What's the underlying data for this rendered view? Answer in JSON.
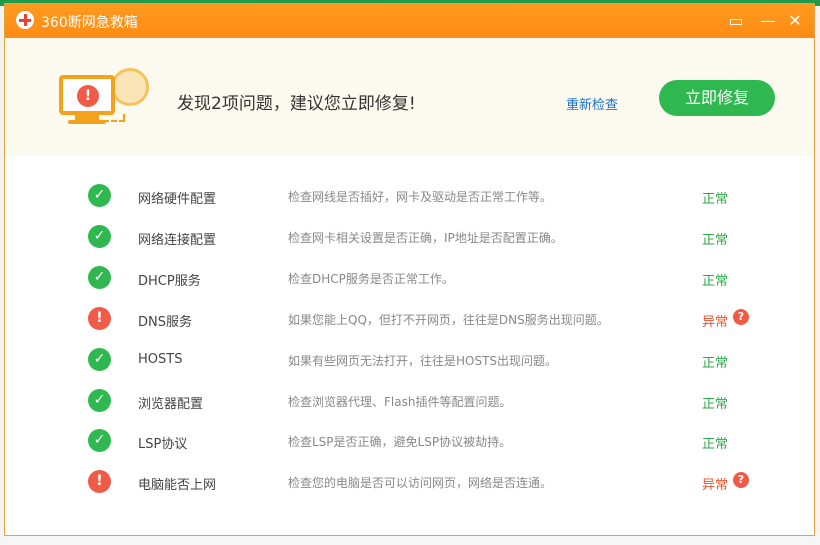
{
  "window": {
    "title": "360断网急救箱",
    "icons": {
      "logo": "red-cross-icon",
      "feedback": "feedback-icon",
      "minimize": "minimize-icon",
      "close": "close-icon"
    }
  },
  "header": {
    "headline": "发现2项问题，建议您立即修复!",
    "recheck_label": "重新检查",
    "fix_label": "立即修复"
  },
  "items": [
    {
      "name": "网络硬件配置",
      "desc": "检查网线是否插好，网卡及驱动是否正常工作等。",
      "result": "正常",
      "status": "ok"
    },
    {
      "name": "网络连接配置",
      "desc": "检查网卡相关设置是否正确，IP地址是否配置正确。",
      "result": "正常",
      "status": "ok"
    },
    {
      "name": "DHCP服务",
      "desc": "检查DHCP服务是否正常工作。",
      "result": "正常",
      "status": "ok"
    },
    {
      "name": "DNS服务",
      "desc": "如果您能上QQ，但打不开网页，往往是DNS服务出现问题。",
      "result": "异常",
      "status": "err"
    },
    {
      "name": "HOSTS",
      "desc": "如果有些网页无法打开，往往是HOSTS出现问题。",
      "result": "正常",
      "status": "ok"
    },
    {
      "name": "浏览器配置",
      "desc": "检查浏览器代理、Flash插件等配置问题。",
      "result": "正常",
      "status": "ok"
    },
    {
      "name": "LSP协议",
      "desc": "检查LSP是否正确，避免LSP协议被劫持。",
      "result": "正常",
      "status": "ok"
    },
    {
      "name": "电脑能否上网",
      "desc": "检查您的电脑是否可以访问网页，网络是否连通。",
      "result": "异常",
      "status": "err"
    }
  ],
  "colors": {
    "title_bar": "#ff8b14",
    "ok": "#2fb84f",
    "error": "#ef5b47",
    "link": "#1b6fc4"
  }
}
